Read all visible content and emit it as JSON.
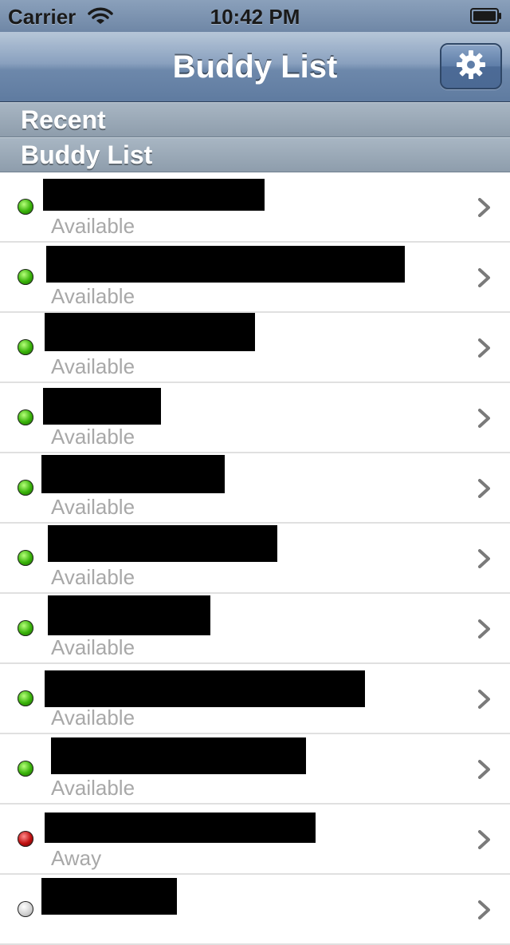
{
  "status_bar": {
    "carrier": "Carrier",
    "time": "10:42 PM",
    "wifi_icon": "wifi-icon",
    "battery_icon": "battery-icon"
  },
  "nav": {
    "title": "Buddy List",
    "settings_icon": "gear-icon"
  },
  "sections": {
    "recent": "Recent",
    "buddy_list": "Buddy List"
  },
  "buddies": [
    {
      "status": "Available",
      "presence": "available"
    },
    {
      "status": "Available",
      "presence": "available"
    },
    {
      "status": "Available",
      "presence": "available"
    },
    {
      "status": "Available",
      "presence": "available"
    },
    {
      "status": "Available",
      "presence": "available"
    },
    {
      "status": "Available",
      "presence": "available"
    },
    {
      "status": "Available",
      "presence": "available"
    },
    {
      "status": "Available",
      "presence": "available"
    },
    {
      "status": "Available",
      "presence": "available"
    },
    {
      "status": "Away",
      "presence": "away"
    },
    {
      "status": "",
      "presence": "offline"
    }
  ],
  "colors": {
    "available": "#39b30a",
    "away": "#c01010",
    "nav_bar": "#6d88ab",
    "status_text": "#a8a8a8"
  }
}
